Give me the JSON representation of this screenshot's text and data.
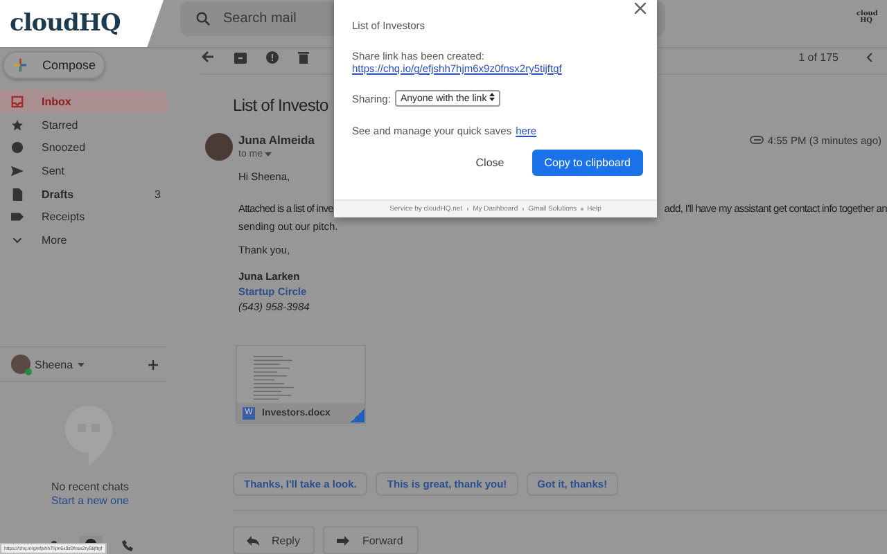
{
  "logo": {
    "text": "cloudHQ"
  },
  "search": {
    "placeholder": "Search mail"
  },
  "header": {
    "app_badge": "cloud HQ"
  },
  "compose": {
    "label": "Compose"
  },
  "sidebar": {
    "items": [
      {
        "label": "Inbox",
        "selected": true,
        "unread": true
      },
      {
        "label": "Starred",
        "selected": false,
        "unread": false
      },
      {
        "label": "Snoozed",
        "selected": false,
        "unread": false
      },
      {
        "label": "Sent",
        "selected": false,
        "unread": false
      },
      {
        "label": "Drafts",
        "selected": false,
        "unread": true,
        "count": "3"
      },
      {
        "label": "Receipts",
        "selected": false,
        "unread": false
      },
      {
        "label": "More",
        "selected": false,
        "unread": false
      }
    ]
  },
  "chat": {
    "user": "Sheena",
    "online": true,
    "empty_text": "No recent chats",
    "start_link": "Start a new one"
  },
  "pager": {
    "text": "1 of 175"
  },
  "message": {
    "subject": "List of Investo",
    "sender": "Juna Almeida",
    "to": "to me",
    "time": "4:55 PM (3 minutes ago)",
    "greeting": "Hi Sheena,",
    "body_left": "Attached is a list of inve",
    "body_right": "add, I'll have my assistant get contact info together an",
    "body_line2": "sending out our pitch.",
    "closing": "Thank you,",
    "sig_name": "Juna Larken",
    "sig_company": "Startup Circle",
    "sig_phone": "(543) 958-3984",
    "attachment": {
      "name": "Investors.docx",
      "badge": "W"
    }
  },
  "smart_replies": [
    "Thanks, I'll take a look.",
    "This is great, thank you!",
    "Got it, thanks!"
  ],
  "actions": [
    "Reply",
    "Forward"
  ],
  "link_preview": "https://chq.io/g/efjshh7hjm6x9z0fnsx2ry5tijftgf",
  "modal": {
    "title": "List of Investors",
    "created_text": "Share link has been created:",
    "link": "https://chq.io/g/efjshh7hjm6x9z0fnsx2ry5tijftgf",
    "sharing_label": "Sharing:",
    "sharing_value": "Anyone with the link",
    "manage_text": "See and manage your quick saves",
    "manage_link": "here",
    "close": "Close",
    "copy": "Copy to clipboard",
    "footer": [
      "Service by cloudHQ.net",
      "My Dashboard",
      "Gmail Solutions",
      "Help"
    ]
  }
}
